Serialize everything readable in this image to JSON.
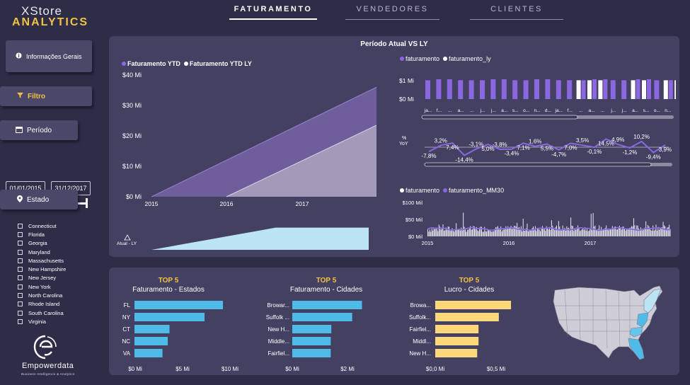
{
  "brand": {
    "line1": "XStore",
    "line2": "ANALYTICS"
  },
  "nav": {
    "tabs": [
      {
        "label": "FATURAMENTO"
      },
      {
        "label": "VENDEDORES"
      },
      {
        "label": "CLIENTES"
      }
    ]
  },
  "sidebar": {
    "info_label": "Informações Gerais",
    "filter_label": "Filtro",
    "period_label": "Período",
    "date_from": "01/01/2015",
    "date_to": "31/12/2017",
    "state_label": "Estado",
    "states": [
      "Connecticut",
      "Florida",
      "Georgia",
      "Maryland",
      "Massachusetts",
      "New Hampshire",
      "New Jersey",
      "New York",
      "North Carolina",
      "Rhode Island",
      "South Carolina",
      "Virginia"
    ]
  },
  "logo": {
    "name": "Empowerdata",
    "tagline": "Business Intelligence & Analytics"
  },
  "colors": {
    "purple": "#8b67e0",
    "purple_area": "#6f5d9c",
    "grey_area": "#a29ab8",
    "cyan": "#4fbbe8",
    "light_blue": "#bde4f4",
    "yellow": "#fdd87a",
    "white": "#ffffff"
  },
  "main": {
    "title": "Período Atual VS LY"
  },
  "chart_data": [
    {
      "type": "area",
      "id": "ytd",
      "series": [
        {
          "name": "Faturamento YTD",
          "values": [
            0,
            36
          ]
        },
        {
          "name": "Faturamento YTD LY",
          "values": [
            0,
            23.5
          ]
        }
      ],
      "x": [
        "2015",
        "2016",
        "2017"
      ],
      "yticks": [
        "$40 Mi",
        "$30 Mi",
        "$20 Mi",
        "$10 Mi",
        "$0 Mi"
      ],
      "ylim": [
        0,
        40
      ],
      "xlabel": "",
      "ylabel": ""
    },
    {
      "type": "area",
      "id": "delta",
      "ylabel": "Atual - LY",
      "values": [
        0,
        1,
        2,
        3,
        4,
        5,
        6,
        7,
        8,
        8,
        8,
        8,
        8,
        8,
        8
      ]
    },
    {
      "type": "bar",
      "id": "monthly",
      "series": [
        {
          "name": "faturamento"
        },
        {
          "name": "faturamento_ly"
        }
      ],
      "categories": [
        "ja...",
        "f...",
        "...",
        "a...",
        "...",
        "j...",
        "j...",
        "a...",
        "s...",
        "o...",
        "n...",
        "d...",
        "ja...",
        "f...",
        "...",
        "a...",
        "...",
        "j...",
        "j...",
        "a...",
        "s...",
        "o...",
        "n...",
        "d..."
      ],
      "values": [
        0.95,
        1.0,
        1.0,
        0.95,
        0.95,
        0.95,
        1.0,
        1.0,
        0.95,
        0.95,
        1.0,
        1.0,
        0.95,
        0.95,
        0.95,
        1.0,
        1.0,
        0.95,
        0.95,
        1.0,
        1.0,
        0.95,
        0.95,
        0.95
      ],
      "ly_values": [
        0,
        0,
        0,
        0,
        0,
        0,
        0,
        0,
        0,
        0,
        0,
        0,
        0,
        0,
        0.95,
        0.95,
        0.95,
        0,
        0,
        0.95,
        0.95,
        0,
        0.95,
        0.95
      ],
      "yticks": [
        "$1 Mi",
        "$0 Mi"
      ],
      "ylim": [
        0,
        1
      ]
    },
    {
      "type": "line",
      "id": "yoy",
      "ylabel": "% YoY",
      "values": [
        -7.8,
        3.2,
        7.4,
        -14.4,
        -3.1,
        5.0,
        -3.8,
        -3.4,
        7.1,
        1.6,
        5.5,
        -4.7,
        7.0,
        3.5,
        -0.1,
        14.5,
        4.9,
        -1.2,
        10.2,
        -9.4,
        3.9
      ],
      "labels": [
        "-7,8%",
        "3,2%",
        "7,4%",
        "-14,4%",
        "-3,1%",
        "5,0%",
        "-3,8%",
        "-3,4%",
        "7,1%",
        "1,6%",
        "5,5%",
        "-4,7%",
        "7,0%",
        "3,5%",
        "-0,1%",
        "14,5%",
        "4,9%",
        "-1,2%",
        "10,2%",
        "-9,4%",
        "3,9%"
      ],
      "label_pos": [
        "b",
        "a",
        "b",
        "b",
        "a",
        "b",
        "a",
        "b",
        "b",
        "a",
        "b",
        "b",
        "b",
        "a",
        "b",
        "b",
        "a",
        "b",
        "a",
        "b",
        "b"
      ]
    },
    {
      "type": "bar",
      "id": "daily",
      "series": [
        {
          "name": "faturamento"
        },
        {
          "name": "faturamento_MM30"
        }
      ],
      "x": [
        "2015",
        "2016",
        "2017"
      ],
      "yticks": [
        "$100 Mil",
        "$50 Mil",
        "$0 Mil"
      ],
      "ylim": [
        0,
        100
      ],
      "mm30_level": 22
    },
    {
      "type": "bar",
      "id": "top_states",
      "title": "TOP 5",
      "subtitle": "Faturamento - Estados",
      "categories": [
        "FL",
        "NY",
        "CT",
        "NC",
        "VA"
      ],
      "values": [
        10.1,
        8.0,
        4.0,
        3.8,
        3.2
      ],
      "xticks": [
        "$0 Mi",
        "$5 Mi",
        "$10 Mi"
      ],
      "xlim": [
        0,
        10.5
      ]
    },
    {
      "type": "bar",
      "id": "top_cities",
      "title": "TOP 5",
      "subtitle": "Faturamento - Cidades",
      "categories": [
        "Browar...",
        "Suffolk ...",
        "New H...",
        "Middle...",
        "Fairfiel..."
      ],
      "values": [
        2.5,
        2.15,
        1.4,
        1.38,
        1.38
      ],
      "xticks": [
        "$0 Mi",
        "$2 Mi"
      ],
      "xlim": [
        0,
        3.3
      ]
    },
    {
      "type": "bar",
      "id": "top_profit",
      "title": "TOP 5",
      "subtitle": "Lucro - Cidades",
      "categories": [
        "Browa...",
        "Suffolk...",
        "Fairfiel...",
        "Middl...",
        "New H..."
      ],
      "values": [
        0.56,
        0.47,
        0.32,
        0.32,
        0.31
      ],
      "xticks": [
        "$0,0 Mi",
        "$0,5 Mi"
      ],
      "xlim": [
        0,
        0.68
      ]
    }
  ]
}
